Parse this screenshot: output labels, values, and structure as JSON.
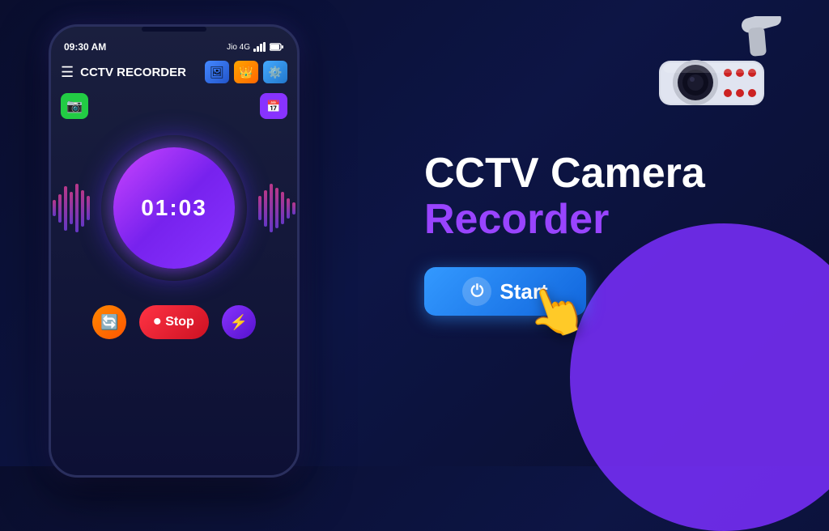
{
  "app": {
    "title": "CCTV RECORDER",
    "status_time": "09:30 AM",
    "status_carrier": "Jio 4G"
  },
  "heading": {
    "line1": "CCTV Camera",
    "line2": "Recorder"
  },
  "timer": {
    "display": "01:03"
  },
  "buttons": {
    "stop_label": "Stop",
    "start_label": "Start"
  }
}
